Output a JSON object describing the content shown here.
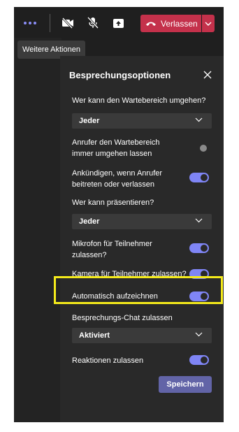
{
  "toolbar": {
    "more_icon": "more-dots-icon",
    "camera_icon": "camera-off-icon",
    "mic_icon": "mic-off-icon",
    "share_icon": "share-screen-icon",
    "leave_label": "Verlassen",
    "leave_icon": "phone-hangup-icon",
    "leave_color": "#c4314b"
  },
  "tooltip": {
    "text": "Weitere Aktionen"
  },
  "panel": {
    "title": "Besprechungsoptionen",
    "close_icon": "close-icon",
    "lobby_question": "Wer kann den Wartebereich umgehen?",
    "lobby_value": "Jeder",
    "callers_bypass_label": "Anrufer den Wartebereich immer umgehen lassen",
    "callers_bypass_on": false,
    "announce_label": "Ankündigen, wenn Anrufer beitreten oder verlassen",
    "announce_on": true,
    "presenter_question": "Wer kann präsentieren?",
    "presenter_value": "Jeder",
    "mic_label": "Mikrofon für Teilnehmer zulassen?",
    "mic_on": true,
    "camera_label": "Kamera für Teilnehmer zulassen?",
    "camera_on": true,
    "autorecord_label": "Automatisch aufzeichnen",
    "autorecord_on": true,
    "chat_question": "Besprechungs-Chat zulassen",
    "chat_value": "Aktiviert",
    "reactions_label": "Reaktionen zulassen",
    "reactions_on": true,
    "save_label": "Speichern",
    "accent_color": "#7f85f5",
    "highlight_color": "#f4ea1b"
  }
}
